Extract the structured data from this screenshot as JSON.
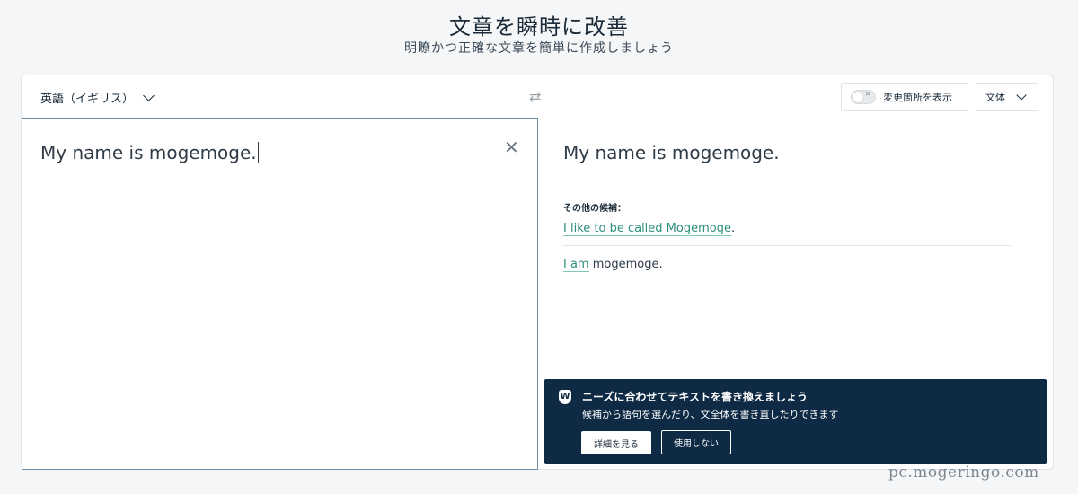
{
  "header": {
    "title": "文章を瞬時に改善",
    "subtitle": "明瞭かつ正確な文章を簡単に作成しましょう"
  },
  "toolbar": {
    "language": "英語（イギリス）",
    "show_changes_label": "変更箇所を表示",
    "style_label": "文体"
  },
  "input": {
    "text": "My name is mogemoge."
  },
  "output": {
    "text": "My name is mogemoge.",
    "other_candidates_label": "その他の候補：",
    "alternatives": [
      {
        "highlight": "I like to be called Mogemoge",
        "rest": "."
      },
      {
        "highlight": "I am",
        "rest": " mogemoge."
      }
    ]
  },
  "banner": {
    "icon": "w-logo-icon",
    "title": "ニーズに合わせてテキストを書き換えましょう",
    "description": "候補から語句を選んだり、文全体を書き直したりできます",
    "detail_button": "詳細を見る",
    "dismiss_button": "使用しない"
  },
  "watermark": "pc.mogeringo.com",
  "colors": {
    "banner_bg": "#0e2a44",
    "highlight": "#2b8f7d",
    "active_border": "#6b8fa8"
  }
}
